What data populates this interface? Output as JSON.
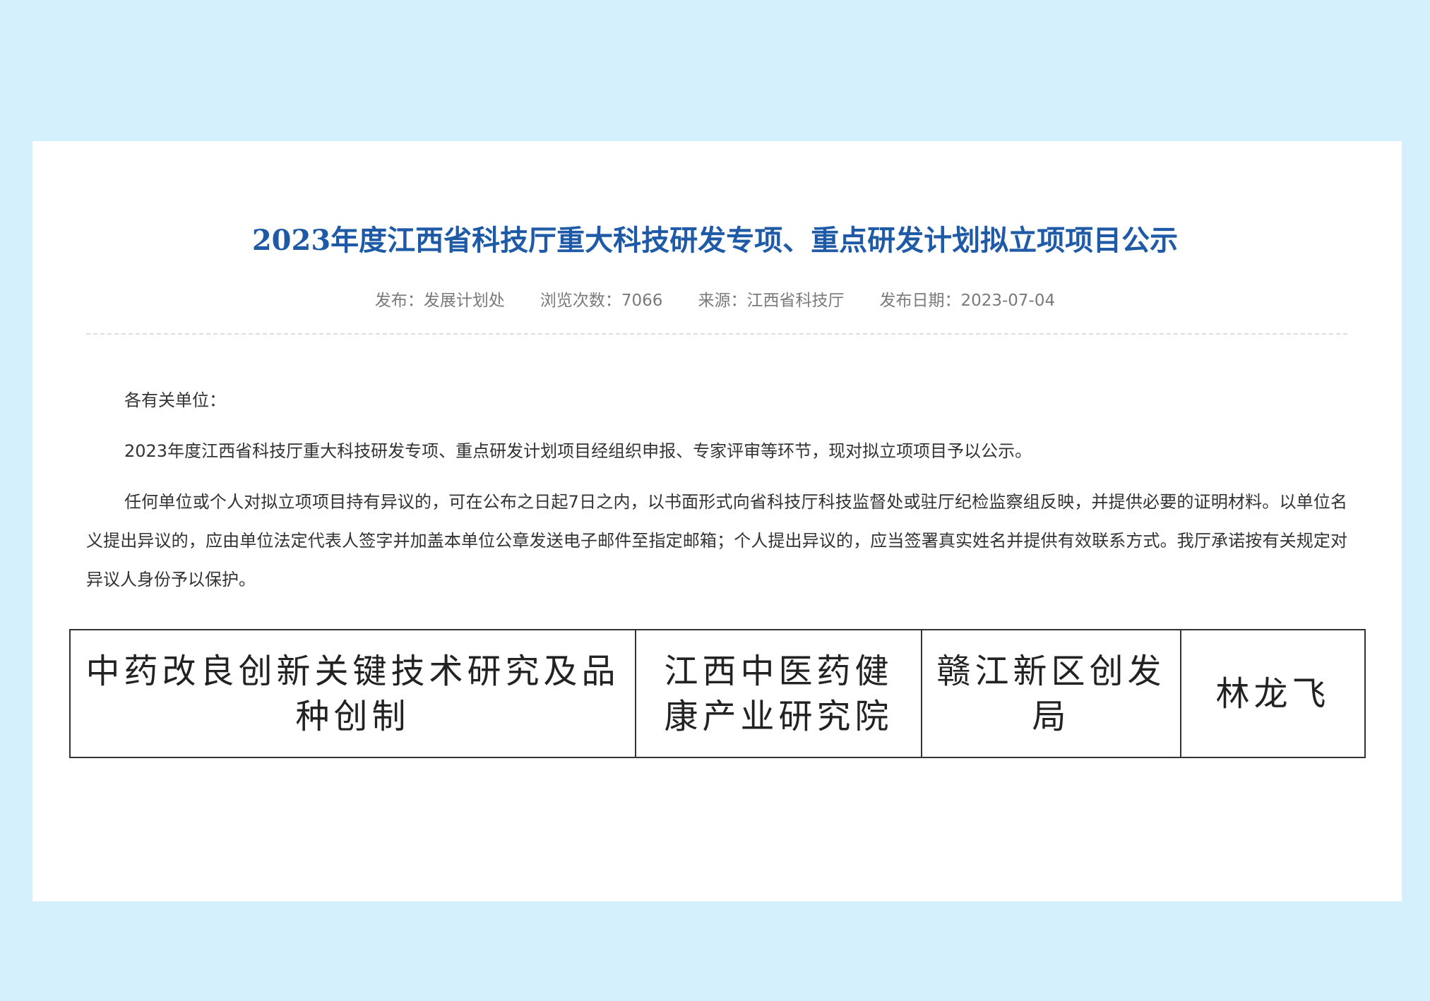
{
  "article": {
    "title": "2023年度江西省科技厅重大科技研发专项、重点研发计划拟立项项目公示",
    "meta": {
      "publisher": "发布：发展计划处",
      "views": "浏览次数：7066",
      "source": "来源：江西省科技厅",
      "date": "发布日期：2023-07-04"
    },
    "greeting": "各有关单位：",
    "paragraph1": "2023年度江西省科技厅重大科技研发专项、重点研发计划项目经组织申报、专家评审等环节，现对拟立项项目予以公示。",
    "paragraph2": "任何单位或个人对拟立项项目持有异议的，可在公布之日起7日之内，以书面形式向省科技厅科技监督处或驻厅纪检监察组反映，并提供必要的证明材料。以单位名义提出异议的，应由单位法定代表人签字并加盖本单位公章发送电子邮件至指定邮箱；个人提出异议的，应当签署真实姓名并提供有效联系方式。我厅承诺按有关规定对异议人身份予以保护。"
  },
  "project_table": {
    "rows": [
      {
        "project": "中药改良创新关键技术研究及品种创制",
        "unit": "江西中医药健康产业研究院",
        "recommender": "赣江新区创发局",
        "leader": "林龙飞"
      }
    ]
  }
}
